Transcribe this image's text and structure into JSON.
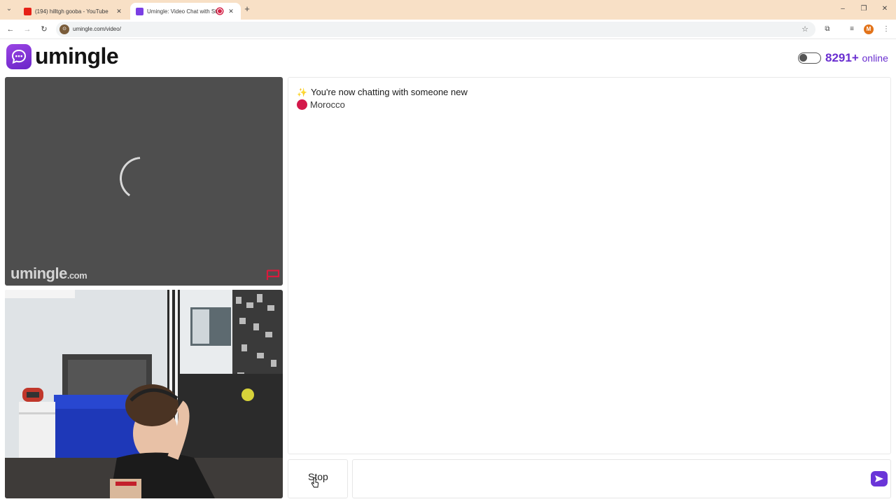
{
  "browser": {
    "tabs": [
      {
        "title": "(194) hilltgh gooba - YouTube",
        "favicon_color": "#e62117",
        "active": false
      },
      {
        "title": "Umingle: Video Chat with St",
        "favicon_color": "#7b3fe4",
        "active": true
      }
    ],
    "url": "umingle.com/video/",
    "profile_initial": "M"
  },
  "header": {
    "logo_text": "umingle",
    "online_count": "8291",
    "online_plus": "+",
    "online_label": "online"
  },
  "stranger_video": {
    "watermark": "umingle",
    "watermark_suffix": ".com",
    "state": "loading"
  },
  "chat": {
    "status_message": "You're now chatting with someone new",
    "country": "Morocco",
    "stop_label": "Stop",
    "input_value": ""
  },
  "colors": {
    "brand": "#6a2fd0",
    "country_dot": "#d3184a",
    "report_flag": "#d81b3c"
  }
}
